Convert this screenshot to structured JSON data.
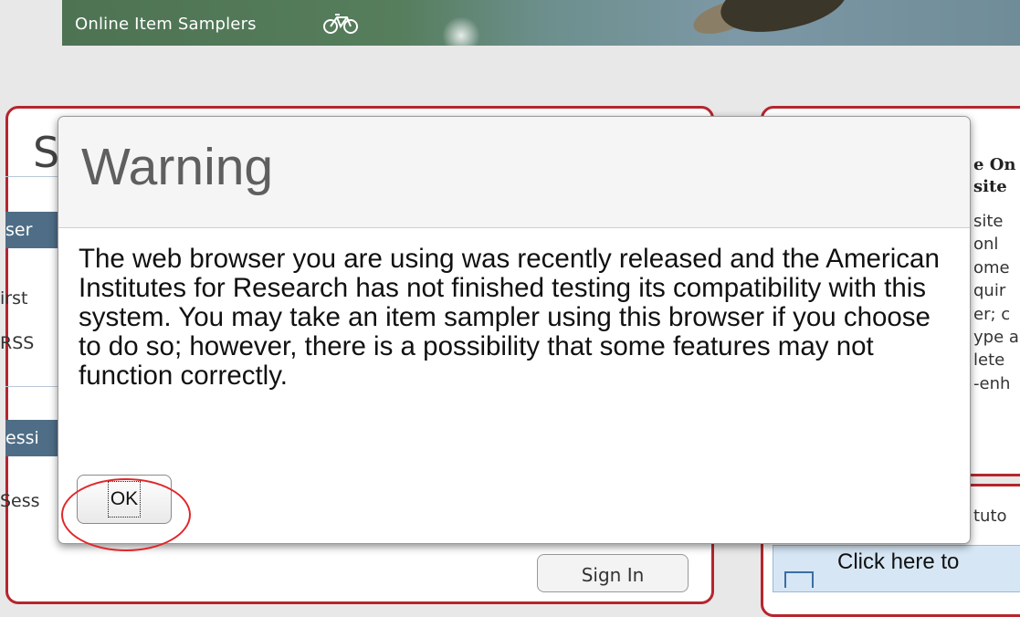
{
  "banner": {
    "title": "Online Item Samplers",
    "icon": "bicycle-icon"
  },
  "background": {
    "heading_partial": "S",
    "left_items": [
      {
        "text": "ser",
        "style": "bar"
      },
      {
        "text": "irst",
        "style": "text"
      },
      {
        "text": "RSS",
        "style": "text"
      },
      {
        "text": "essi",
        "style": "bar"
      },
      {
        "text": "Sess",
        "style": "text"
      }
    ],
    "signin_label": "Sign In",
    "right_bold": [
      "e On",
      "site"
    ],
    "right_lines": [
      "site",
      "onl",
      "ome",
      "quir",
      "er; c",
      "ype a",
      "lete",
      "-enh"
    ],
    "right_footer_text": "tuto",
    "click_here_label": "Click here to"
  },
  "dialog": {
    "title": "Warning",
    "message": "The web browser you are using was recently released and the American Institutes for Research has not finished testing its compatibility with this system. You may take an item sampler using this browser if you choose to do so; however, there is a possibility that some features may not function correctly.",
    "ok_label": "OK"
  },
  "annotation": {
    "highlight_color": "#e0272a",
    "highlight_target": "ok-button"
  }
}
